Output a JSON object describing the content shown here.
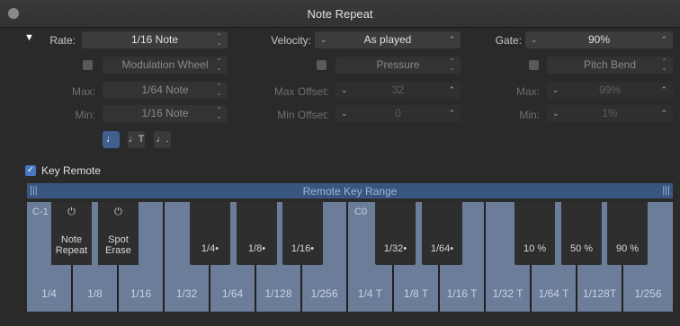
{
  "window": {
    "title": "Note Repeat"
  },
  "rate": {
    "label": "Rate:",
    "value": "1/16 Note",
    "mod_source": "Modulation Wheel",
    "max_label": "Max:",
    "max_value": "1/64 Note",
    "min_label": "Min:",
    "min_value": "1/16 Note",
    "note_buttons": [
      "♩",
      "♩T",
      "♩."
    ]
  },
  "velocity": {
    "label": "Velocity:",
    "value": "As played",
    "mod_source": "Pressure",
    "max_offset_label": "Max Offset:",
    "max_offset_value": "32",
    "min_offset_label": "Min Offset:",
    "min_offset_value": "0"
  },
  "gate": {
    "label": "Gate:",
    "value": "90%",
    "mod_source": "Pitch Bend",
    "max_label": "Max:",
    "max_value": "99%",
    "min_label": "Min:",
    "min_value": "1%"
  },
  "key_remote": {
    "label": "Key Remote",
    "checked": true,
    "check_glyph": "✓"
  },
  "remote_key_range": {
    "label": "Remote Key Range",
    "handle": "|||"
  },
  "keyboard": {
    "octave_labels": [
      "C-1",
      "C0"
    ],
    "function_keys": [
      {
        "power": "⏻",
        "label": "Note\nRepeat"
      },
      {
        "power": "⏻",
        "label": "Spot\nErase"
      }
    ],
    "black_keys": [
      "1/4•",
      "1/8•",
      "1/16•",
      "1/32•",
      "1/64•",
      "10 %",
      "50 %",
      "90 %"
    ],
    "white_keys": [
      "1/4",
      "1/8",
      "1/16",
      "1/32",
      "1/64",
      "1/128",
      "1/256",
      "1/4 T",
      "1/8 T",
      "1/16 T",
      "1/32 T",
      "1/64 T",
      "1/128T",
      "1/256"
    ]
  },
  "glyphs": {
    "updown": "⌃\n⌄",
    "chev_down": "⌄",
    "chev_up": "⌃",
    "disclosure": "▼"
  },
  "colors": {
    "accent": "#4a78c0",
    "range_bar": "#39567f",
    "white_key": "#6b7d98"
  }
}
